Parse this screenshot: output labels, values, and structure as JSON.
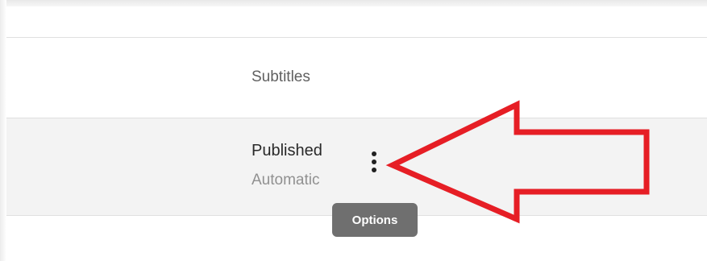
{
  "table": {
    "column_header": "Subtitles",
    "row": {
      "status": "Published",
      "substatus": "Automatic"
    }
  },
  "options": {
    "tooltip": "Options",
    "icon": "more-vert-icon"
  },
  "annotation": {
    "color": "#e61e25"
  }
}
